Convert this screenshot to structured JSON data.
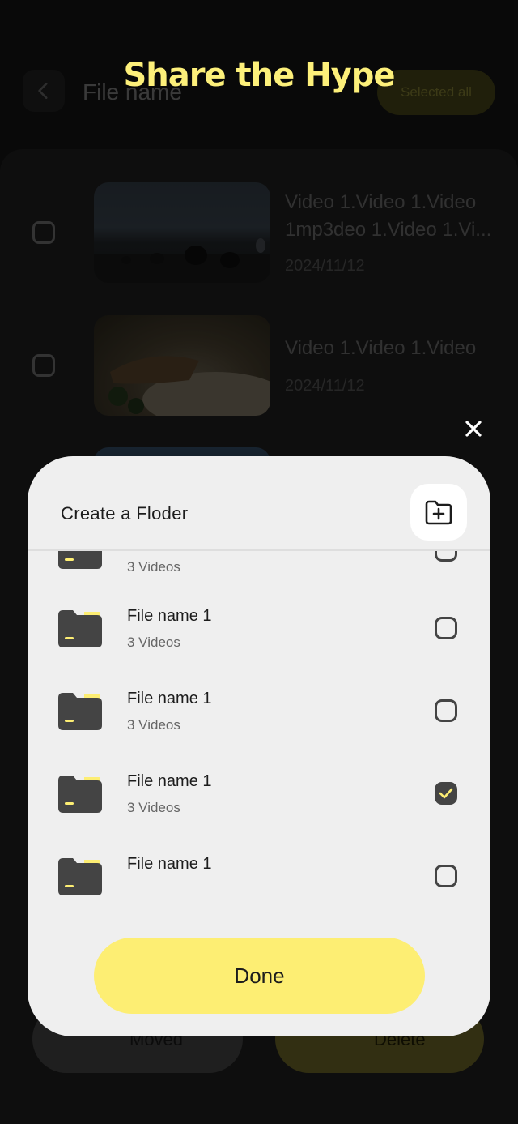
{
  "header": {
    "banner": "Share the Hype",
    "title": "File name",
    "select_all": "Selected all"
  },
  "videos": [
    {
      "title": "Video 1.Video 1.Video 1mp3deo 1.Video 1.Vi...",
      "date": "2024/11/12"
    },
    {
      "title": "Video 1.Video 1.Video",
      "date": "2024/11/12"
    }
  ],
  "bottom_actions": {
    "moved": "Moved",
    "delete": "Delete"
  },
  "modal": {
    "title": "Create a Floder",
    "folders": [
      {
        "name": "",
        "count": "3 Videos",
        "checked": false
      },
      {
        "name": "File name 1",
        "count": "3 Videos",
        "checked": false
      },
      {
        "name": "File name 1",
        "count": "3 Videos",
        "checked": false
      },
      {
        "name": "File name 1",
        "count": "3 Videos",
        "checked": true
      },
      {
        "name": "File name 1",
        "count": "",
        "checked": false
      }
    ],
    "done_label": "Done"
  },
  "colors": {
    "accent": "#fdee73",
    "folder": "#444444",
    "folder_tab": "#fdee73"
  }
}
